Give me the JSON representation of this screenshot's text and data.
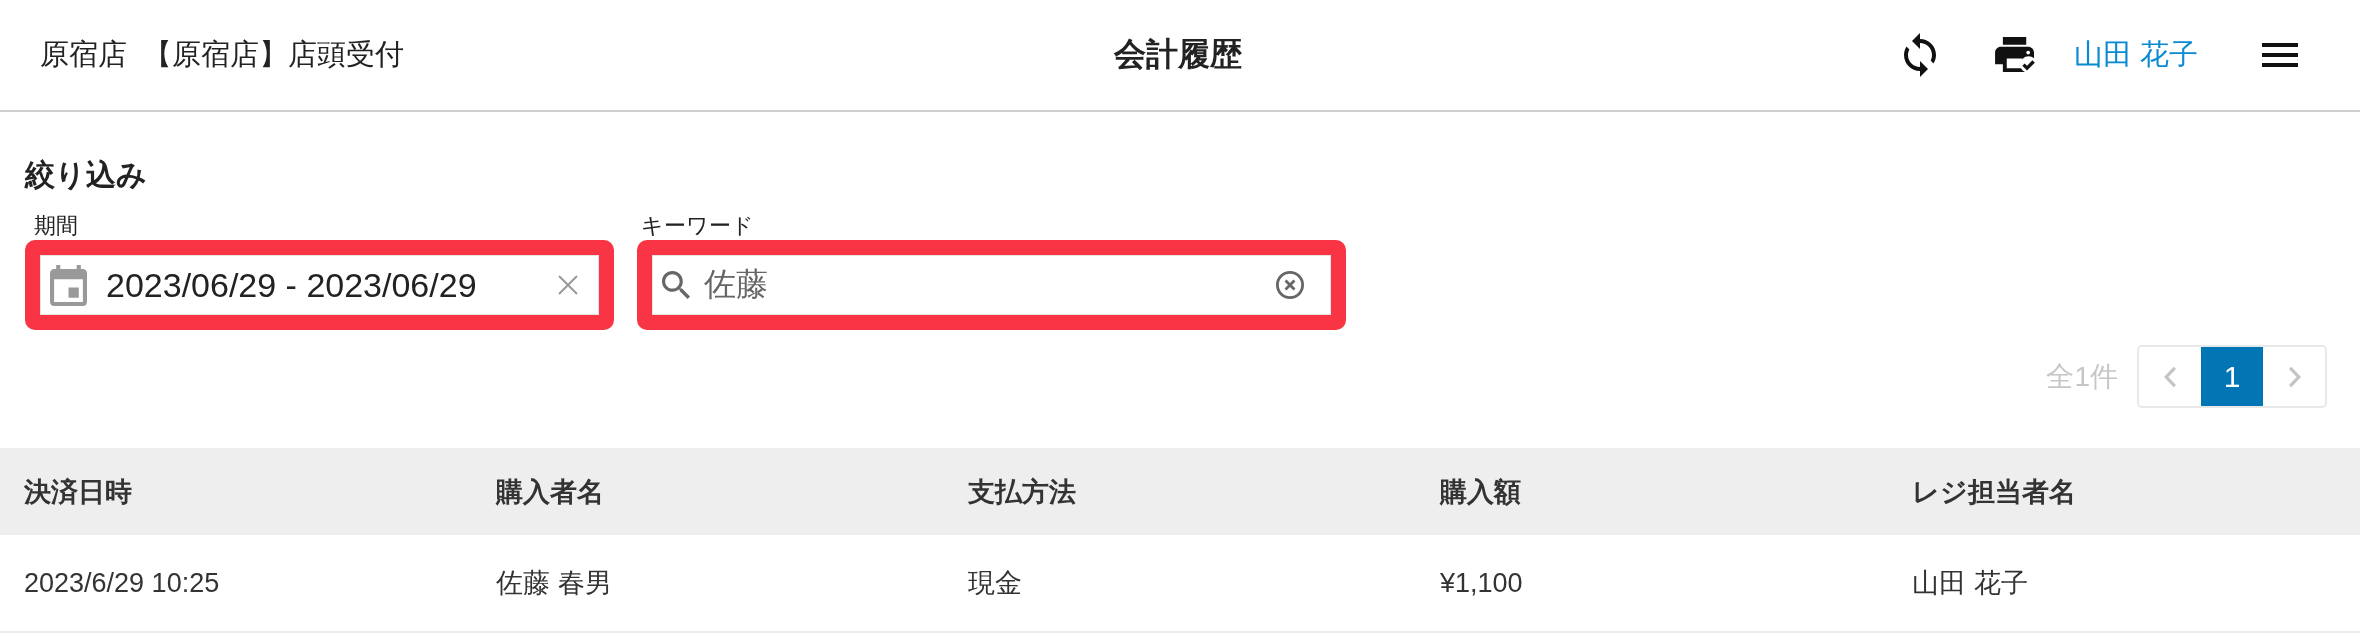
{
  "header": {
    "store": "原宿店",
    "register": "【原宿店】店頭受付",
    "title": "会計履歴",
    "user": "山田 花子"
  },
  "filter": {
    "heading": "絞り込み",
    "fields": [
      {
        "kind": "date_range",
        "label": "期間",
        "value": "2023/06/29 - 2023/06/29",
        "highlighted": true
      },
      {
        "kind": "keyword",
        "label": "キーワード",
        "value": "佐藤",
        "highlighted": true
      }
    ]
  },
  "pagination": {
    "total": "全1件",
    "prev": {
      "disabled": true
    },
    "pages": [
      {
        "label": "1",
        "selected": true
      }
    ],
    "next": {
      "disabled": true
    }
  },
  "table": {
    "columns": [
      "決済日時",
      "購入者名",
      "支払方法",
      "購入額",
      "レジ担当者名"
    ],
    "rows": [
      [
        "2023/6/29 10:25",
        "佐藤 春男",
        "現金",
        "¥1,100",
        "山田 花子"
      ]
    ]
  }
}
